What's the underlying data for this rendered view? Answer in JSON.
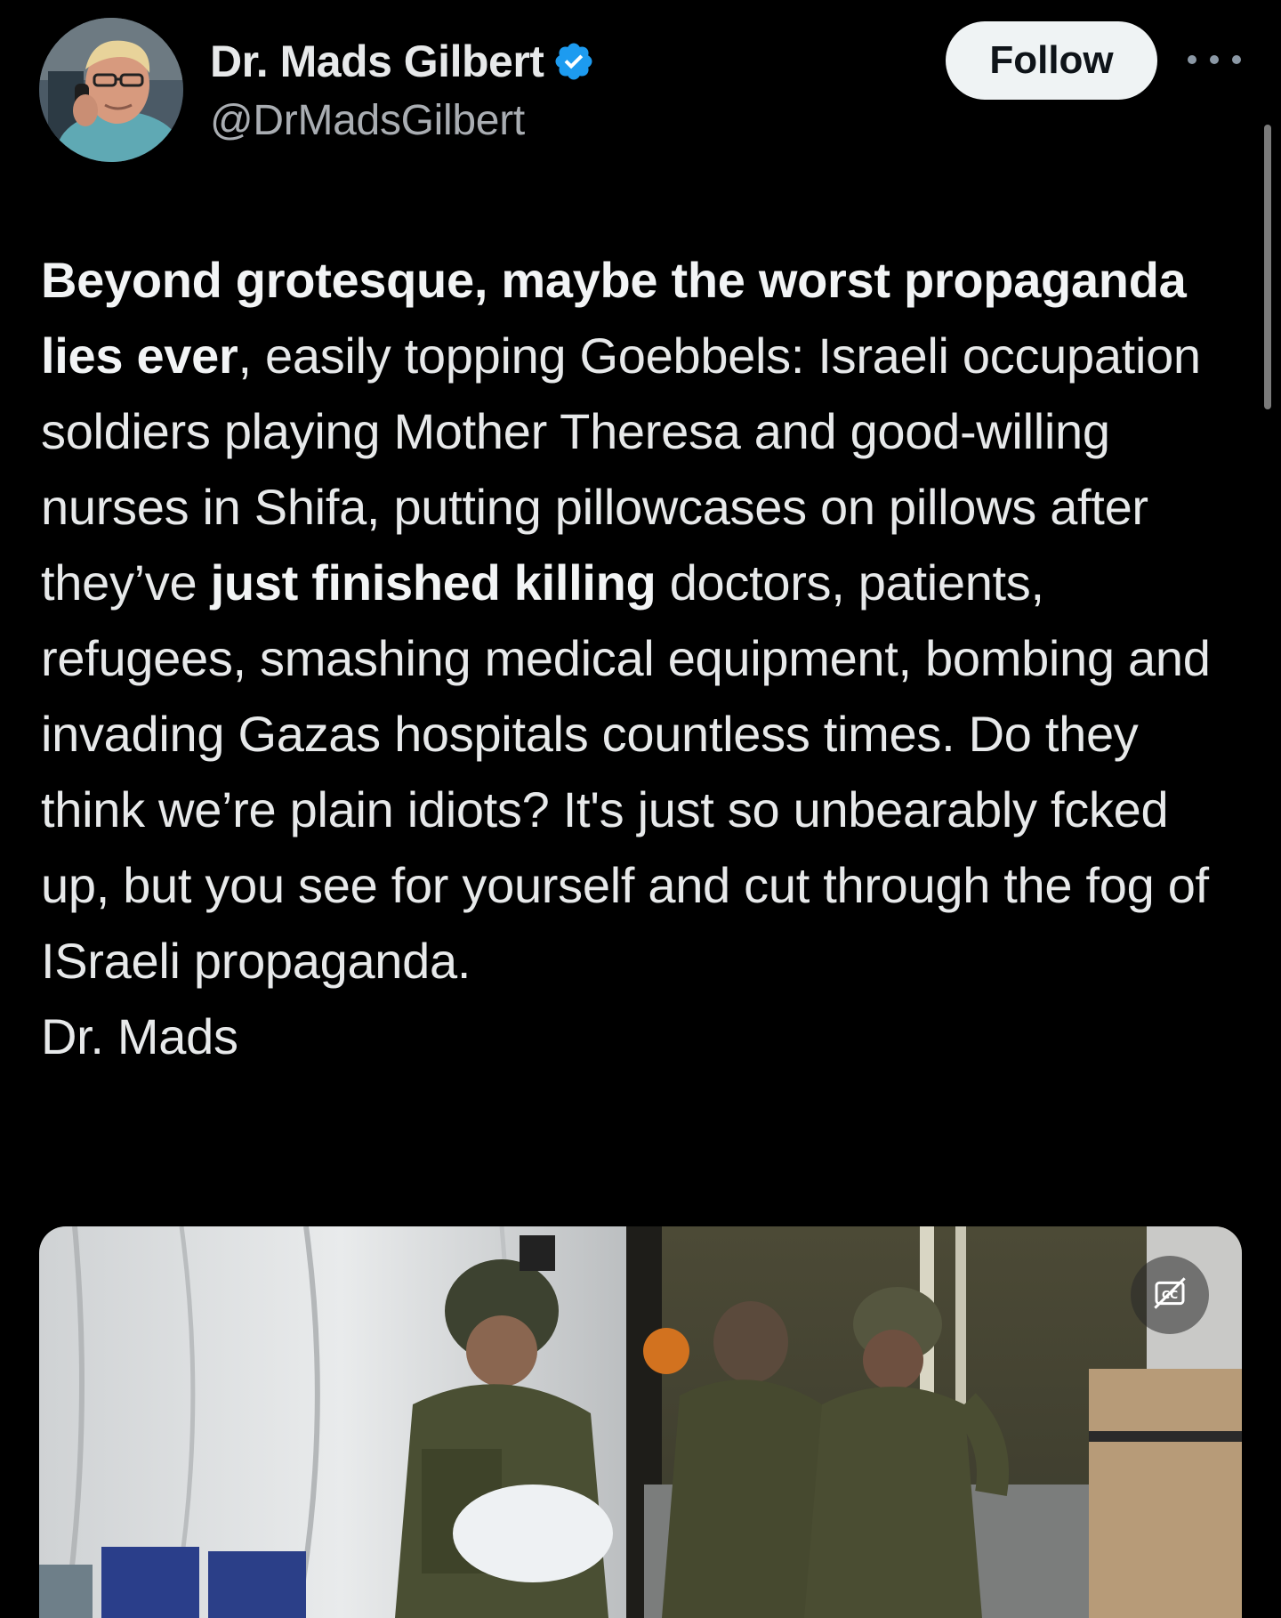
{
  "author": {
    "display_name": "Dr. Mads Gilbert",
    "handle": "@DrMadsGilbert",
    "verified": true
  },
  "actions": {
    "follow_label": "Follow",
    "more_icon": "ellipsis-icon"
  },
  "post": {
    "segments": [
      {
        "bold": true,
        "text": "Beyond grotesque, maybe the worst propaganda lies ever"
      },
      {
        "bold": false,
        "text": ", easily topping Goebbels: Israeli occupation soldiers playing Mother Theresa and good-willing nurses in Shifa, putting pillowcases on pillows after they’ve "
      },
      {
        "bold": true,
        "text": "just finished killing"
      },
      {
        "bold": false,
        "text": " doctors, patients, refugees, smashing medical equipment, bombing and invading Gazas hospitals countless times. Do they think we’re plain idiots? It's just so unbearably fcked up, but you see for yourself and cut through the fog of ISraeli propaganda."
      },
      {
        "bold": false,
        "text": "Dr. Mads"
      }
    ]
  },
  "media": {
    "captions_icon": "closed-captions-off-icon"
  },
  "colors": {
    "background": "#000000",
    "text": "#e7e9ea",
    "secondary_text": "#a9adb2",
    "verified_badge": "#1d9bf0",
    "follow_button_bg": "#eff3f4",
    "follow_button_text": "#0f1419"
  }
}
